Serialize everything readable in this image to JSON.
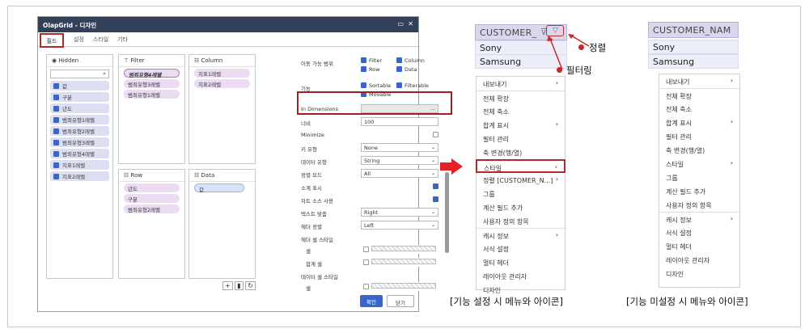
{
  "dialog": {
    "title": "OlapGrid - 디자인",
    "tabs": [
      "필드",
      "설정",
      "스타일",
      "기타"
    ],
    "panes": {
      "hidden": {
        "title": "Hidden",
        "items": [
          "값",
          "구분",
          "년도",
          "범죄유형1레벨",
          "범죄유형2레벨",
          "범죄유형3레벨",
          "범죄유형4레벨",
          "지표1레벨",
          "지표2레벨"
        ]
      },
      "filter": {
        "title": "Filter",
        "items": [
          "범죄유형4레벨",
          "범죄유형3레벨",
          "범죄유형1레벨"
        ]
      },
      "column": {
        "title": "Column",
        "items": [
          "지표1레벨",
          "지표2레벨"
        ]
      },
      "row": {
        "title": "Row",
        "items": [
          "년도",
          "구분",
          "범죄유형2레벨"
        ]
      },
      "data": {
        "title": "Data",
        "items": [
          "값"
        ]
      }
    },
    "props": {
      "move_range": "이동 가능 범위",
      "move_opts": [
        "Filter",
        "Column",
        "Row",
        "Data"
      ],
      "func": "기능",
      "func_opts": [
        "Sortable",
        "Filterable",
        "Movable"
      ],
      "in_dimensions": "In Dimensions",
      "width_label": "너비",
      "width_value": "100",
      "minimize": "Minimize",
      "key_type_label": "키 유형",
      "key_type_value": "None",
      "data_type_label": "데이터 유형",
      "data_type_value": "String",
      "sort_mode_label": "정렬 모드",
      "sort_mode_value": "All",
      "subtotal": "소계 표시",
      "chart_source": "차트 소스 사용",
      "text_align_label": "텍스트 맞춤",
      "text_align_value": "Right",
      "header_align_label": "헤더 정렬",
      "header_align_value": "Left",
      "header_cell_style": "헤더 셀 스타일",
      "cell": "셀",
      "sum_cell": "합계 셀",
      "data_cell_style": "데이터 셀 스타일",
      "cell2": "셀"
    },
    "ok": "확인",
    "close": "닫기"
  },
  "left_menu": {
    "header": "CUSTOMER_",
    "rows": [
      "Sony",
      "Samsung"
    ],
    "annotations": {
      "sort": "정렬",
      "filter": "필터링"
    },
    "items": [
      "내보내기",
      "전체 확장",
      "전체 축소",
      "합계 표시",
      "필터 관리",
      "축 변경(행/열)",
      "스타일",
      "정렬 [CUSTOMER_N...]",
      "그룹",
      "계산 필드 추가",
      "사용자 정의 항목",
      "캐시 정보",
      "서식 설정",
      "멀티 헤더",
      "레이아웃 관리자",
      "디자인"
    ],
    "caption": "[기능 설정 시 메뉴와 아이콘]"
  },
  "right_menu": {
    "header": "CUSTOMER_NAM",
    "rows": [
      "Sony",
      "Samsung"
    ],
    "items": [
      "내보내기",
      "전체 확장",
      "전체 축소",
      "합계 표시",
      "필터 관리",
      "축 변경(행/열)",
      "스타일",
      "그룹",
      "계산 필드 추가",
      "사용자 정의 항목",
      "캐시 정보",
      "서식 설정",
      "멀티 헤더",
      "레이아웃 관리자",
      "디자인"
    ],
    "caption": "[기능 미설정 시 메뉴와 아이콘]"
  },
  "colors": {
    "accent": "#3b66c9",
    "highlight": "#b0292b",
    "title_bar": "#33405a"
  }
}
